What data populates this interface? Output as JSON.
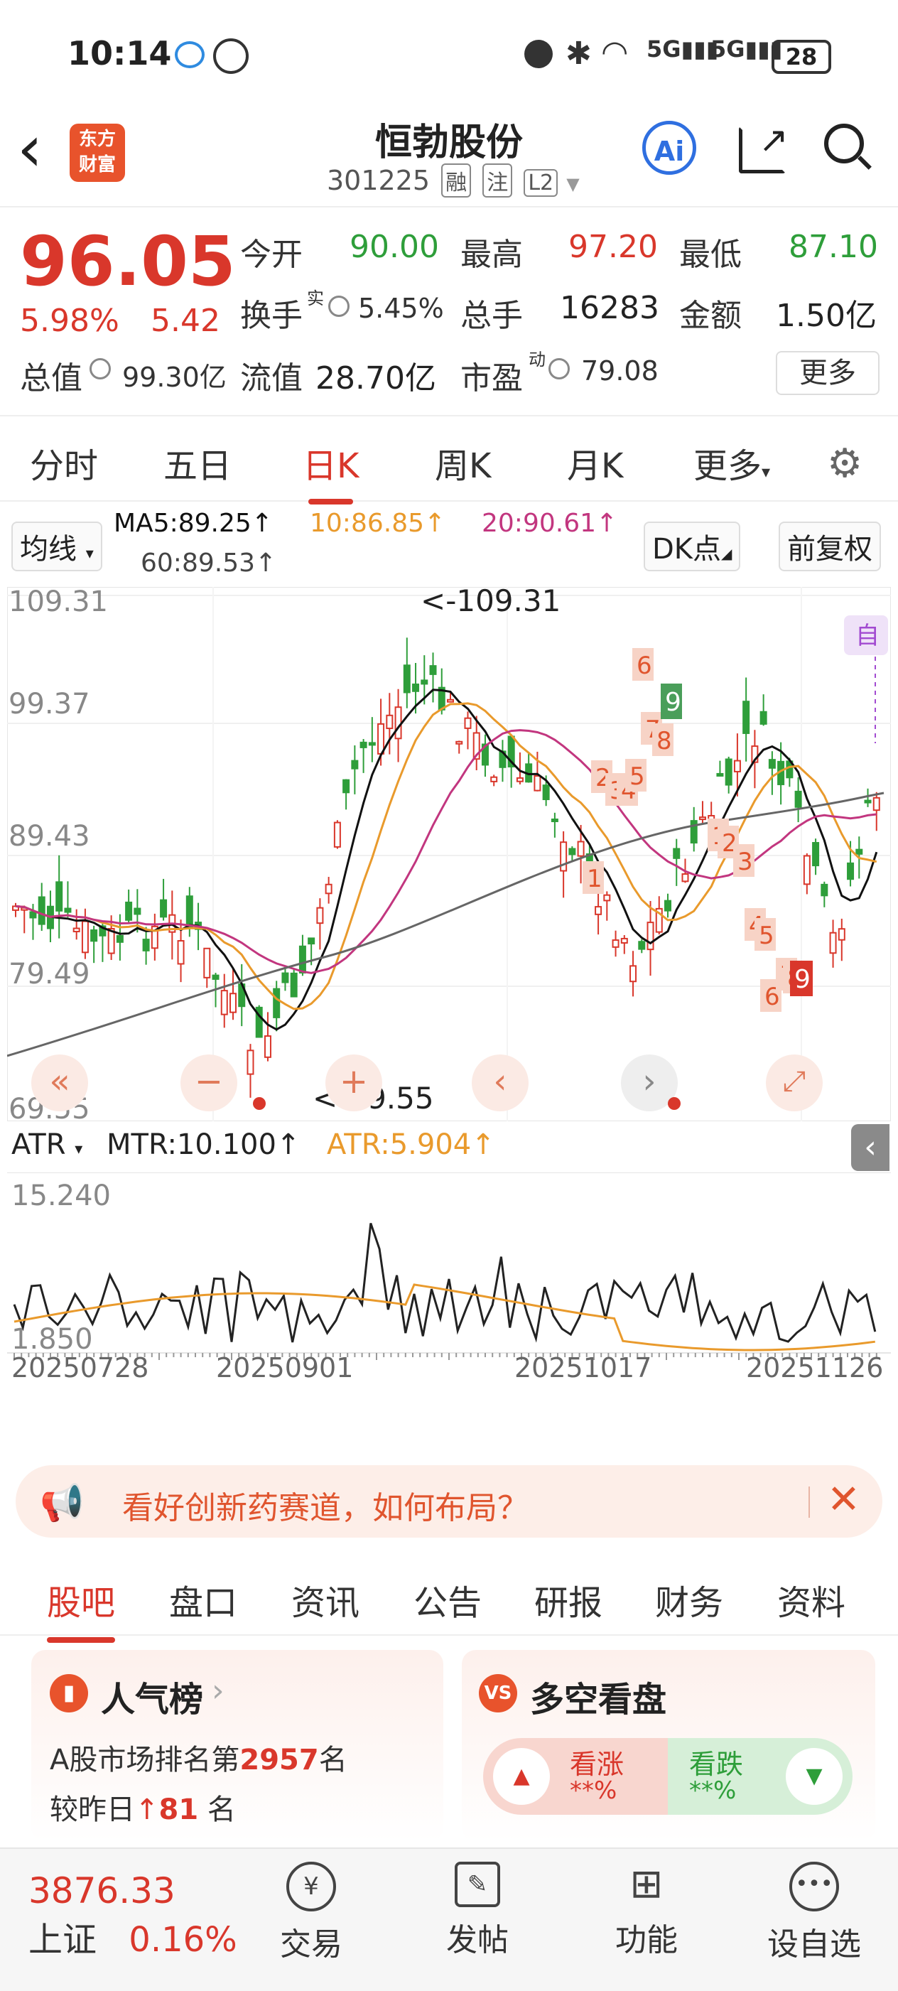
{
  "status_bar": {
    "time": "10:14",
    "battery": "28"
  },
  "header": {
    "back": "‹",
    "logo_line1": "东方",
    "logo_line2": "财富",
    "title": "恒勃股份",
    "code": "301225",
    "tags": [
      "融",
      "注",
      "L2"
    ],
    "ai_label": "Ai"
  },
  "quote": {
    "price": "96.05",
    "change_pct": "5.98%",
    "change": "5.42",
    "open_label": "今开",
    "open": "90.00",
    "high_label": "最高",
    "high": "97.20",
    "low_label": "最低",
    "low": "87.10",
    "turnover_label": "换手",
    "turnover_sup": "实",
    "turnover": "5.45%",
    "volume_label": "总手",
    "volume": "16283",
    "amount_label": "金额",
    "amount": "1.50亿",
    "mktcap_label": "总值",
    "mktcap": "99.30亿",
    "float_label": "流值",
    "float": "28.70亿",
    "pe_label": "市盈",
    "pe_sup": "动",
    "pe": "79.08",
    "more": "更多"
  },
  "ktabs": [
    "分时",
    "五日",
    "日K",
    "周K",
    "月K",
    "更多"
  ],
  "ma": {
    "selector": "均线",
    "ma5": "MA5:89.25↑",
    "ma10": "10:86.85↑",
    "ma20": "20:90.61↑",
    "ma60": "60:89.53↑",
    "dk": "DK点",
    "fq": "前复权"
  },
  "kchart": {
    "y_labels": [
      "109.31",
      "99.37",
      "89.43",
      "79.49",
      "69.55"
    ],
    "max_label": "<-109.31",
    "min_label": "<-69.55",
    "self_label": "自",
    "signals_red": [
      "6",
      "7",
      "8",
      "2",
      "3",
      "4",
      "5",
      "1",
      "1",
      "2",
      "3",
      "4",
      "5",
      "6",
      "7",
      "8"
    ],
    "signals_green": [
      "9"
    ],
    "signal_dark": "9"
  },
  "atr": {
    "selector": "ATR",
    "mtr": "MTR:10.100↑",
    "atr": "ATR:5.904↑",
    "y_labels": [
      "15.240",
      "1.850"
    ],
    "x_labels": [
      "20250728",
      "20250901",
      "20251017",
      "20251126"
    ]
  },
  "banner": {
    "text": "看好创新药赛道，如何布局？"
  },
  "btabs": [
    "股吧",
    "盘口",
    "资讯",
    "公告",
    "研报",
    "财务",
    "资料"
  ],
  "popularity": {
    "title": "人气榜",
    "rank_prefix": "A股市场排名第",
    "rank": "2957",
    "rank_suffix": "名",
    "change_prefix": "较昨日",
    "change": "81",
    "change_suffix": "名"
  },
  "duokong": {
    "title": "多空看盘",
    "up_label": "看涨",
    "up_value": "**%",
    "down_label": "看跌",
    "down_value": "**%"
  },
  "bottom_nav": {
    "index_value": "3876.33",
    "index_name": "上证",
    "index_pct": "0.16%",
    "items": [
      "交易",
      "发帖",
      "功能",
      "设自选"
    ]
  },
  "colors": {
    "up": "#d9372b",
    "down": "#2e9e3a",
    "ma5": "#111111",
    "ma10": "#e99a2c",
    "ma20": "#c2367f",
    "ma60": "#666666"
  }
}
